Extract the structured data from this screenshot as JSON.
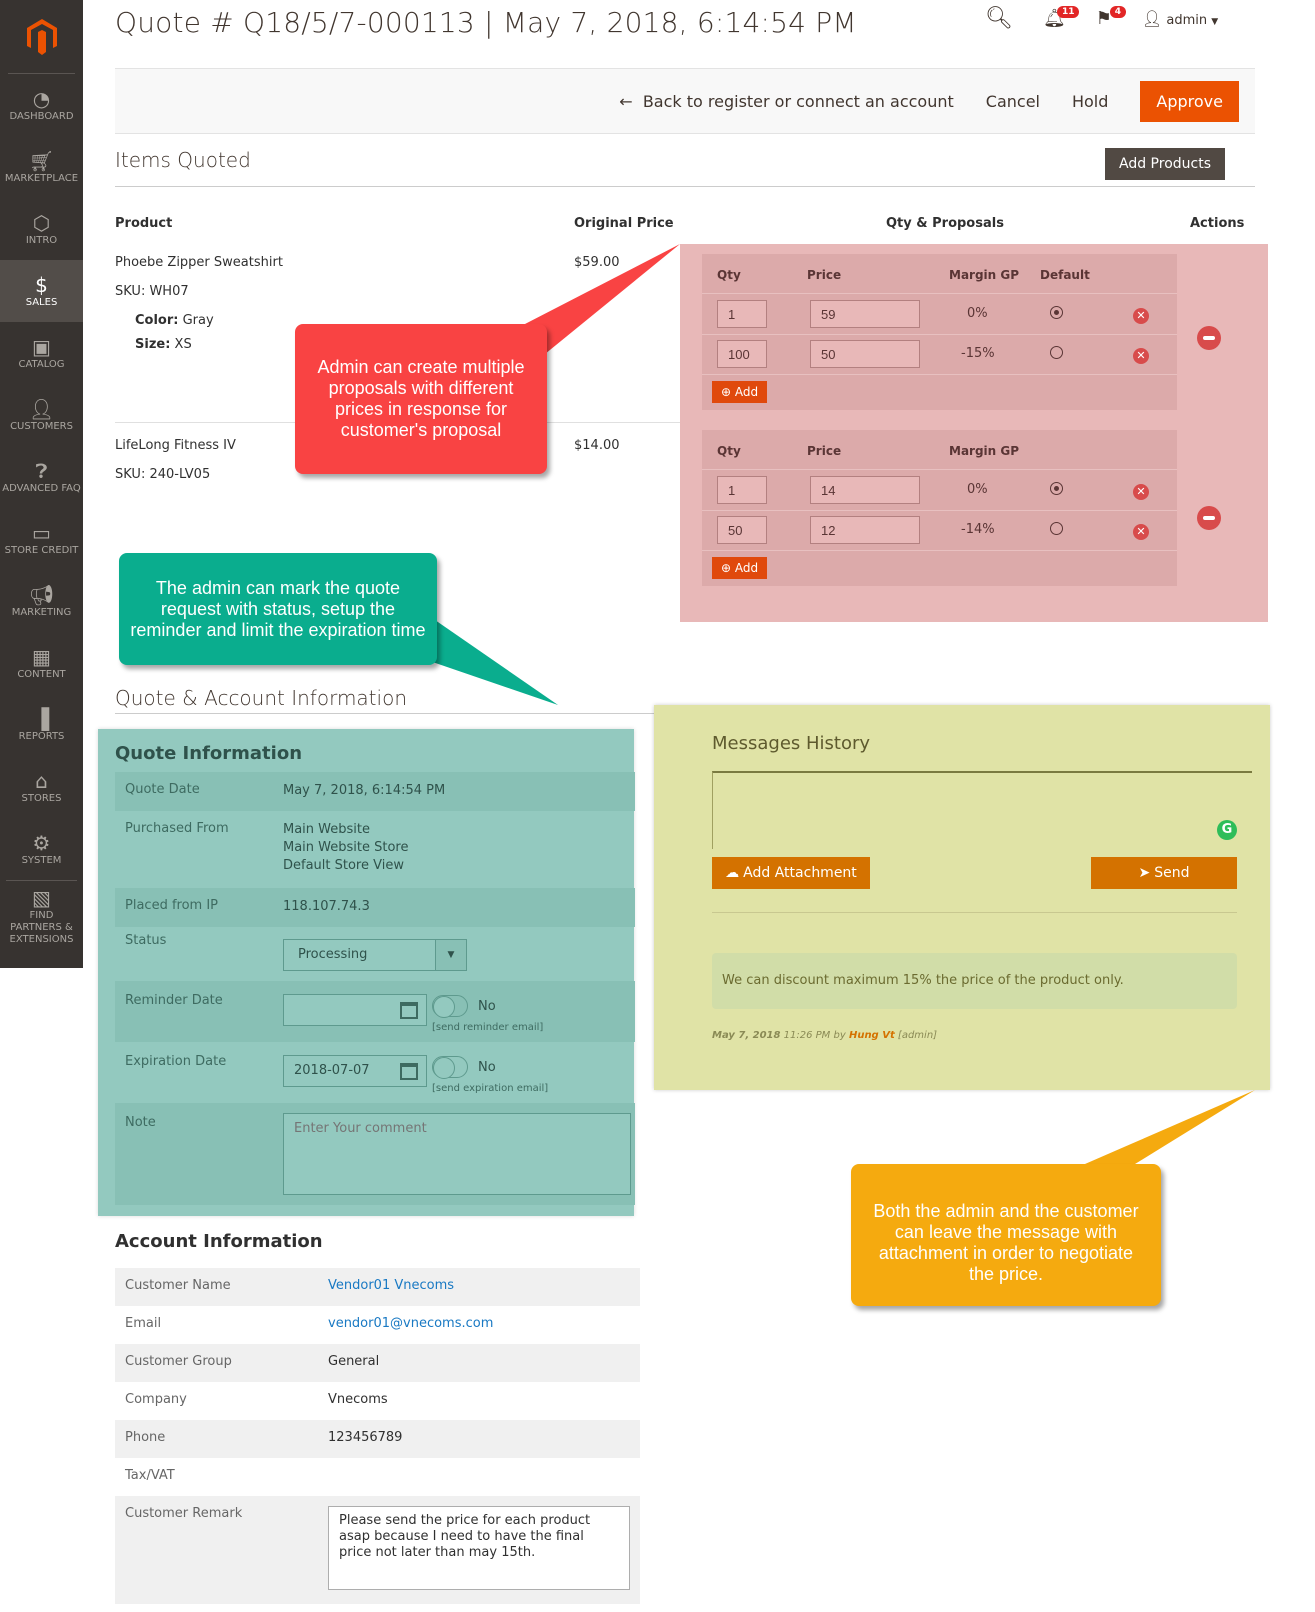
{
  "sidebar": {
    "items": [
      {
        "label": "DASHBOARD",
        "icon": "dashboard-icon"
      },
      {
        "label": "MARKETPLACE",
        "icon": "cart-icon"
      },
      {
        "label": "INTRO",
        "icon": "hexagon-icon"
      },
      {
        "label": "SALES",
        "icon": "dollar-icon",
        "active": true
      },
      {
        "label": "CATALOG",
        "icon": "box-icon"
      },
      {
        "label": "CUSTOMERS",
        "icon": "person-icon"
      },
      {
        "label": "ADVANCED FAQ",
        "icon": "question-icon"
      },
      {
        "label": "STORE CREDIT",
        "icon": "credit-card-icon"
      },
      {
        "label": "MARKETING",
        "icon": "megaphone-icon"
      },
      {
        "label": "CONTENT",
        "icon": "layout-icon"
      },
      {
        "label": "REPORTS",
        "icon": "bar-chart-icon"
      },
      {
        "label": "STORES",
        "icon": "store-icon"
      },
      {
        "label": "SYSTEM",
        "icon": "gear-icon"
      },
      {
        "label": "FIND PARTNERS & EXTENSIONS",
        "icon": "lego-icon"
      }
    ]
  },
  "header": {
    "title": "Quote # Q18/5/7-000113 | May 7, 2018, 6:14:54 PM",
    "notifications_count": "11",
    "flags_count": "4",
    "user": "admin"
  },
  "actions": {
    "back": "Back to register or connect an account",
    "cancel": "Cancel",
    "hold": "Hold",
    "approve": "Approve"
  },
  "items_quoted": {
    "title": "Items Quoted",
    "add_products": "Add Products",
    "columns": {
      "product": "Product",
      "original_price": "Original Price",
      "qty_proposals": "Qty & Proposals",
      "actions": "Actions"
    },
    "proposal_headers": {
      "qty": "Qty",
      "price": "Price",
      "margin": "Margin GP",
      "default": "Default"
    },
    "add_label": "Add",
    "products": [
      {
        "name": "Phoebe Zipper Sweatshirt",
        "sku": "SKU: WH07",
        "options": [
          {
            "label": "Color:",
            "value": "Gray"
          },
          {
            "label": "Size:",
            "value": "XS"
          }
        ],
        "original_price": "$59.00",
        "proposals": [
          {
            "qty": "1",
            "price": "59",
            "margin": "0%",
            "default": true
          },
          {
            "qty": "100",
            "price": "50",
            "margin": "-15%",
            "default": false
          }
        ]
      },
      {
        "name": "LifeLong Fitness IV",
        "sku": "SKU: 240-LV05",
        "options": [],
        "original_price": "$14.00",
        "proposals": [
          {
            "qty": "1",
            "price": "14",
            "margin": "0%",
            "default": true
          },
          {
            "qty": "50",
            "price": "12",
            "margin": "-14%",
            "default": false
          }
        ]
      }
    ]
  },
  "callouts": {
    "red": "Admin can create multiple proposals with different prices in response for customer's proposal",
    "teal": "The admin can mark the quote request with status, setup the reminder and limit the expiration time",
    "orange": "Both the admin and the customer can leave the message with attachment in order to negotiate the price."
  },
  "quote_account": {
    "title": "Quote & Account Information",
    "quote_info": {
      "title": "Quote Information",
      "quote_date_label": "Quote Date",
      "quote_date": "May 7, 2018, 6:14:54 PM",
      "purchased_from_label": "Purchased From",
      "purchased_from": [
        "Main Website",
        "Main Website Store",
        "Default Store View"
      ],
      "ip_label": "Placed from IP",
      "ip": "118.107.74.3",
      "status_label": "Status",
      "status": "Processing",
      "reminder_label": "Reminder Date",
      "reminder_value": "",
      "reminder_toggle": "No",
      "reminder_hint": "[send reminder email]",
      "expiration_label": "Expiration Date",
      "expiration_value": "2018-07-07",
      "expiration_toggle": "No",
      "expiration_hint": "[send expiration email]",
      "note_label": "Note",
      "note_placeholder": "Enter Your comment"
    },
    "account_info": {
      "title": "Account Information",
      "rows": [
        {
          "label": "Customer Name",
          "value": "Vendor01 Vnecoms",
          "link": true
        },
        {
          "label": "Email",
          "value": "vendor01@vnecoms.com",
          "link": true
        },
        {
          "label": "Customer Group",
          "value": "General"
        },
        {
          "label": "Company",
          "value": "Vnecoms"
        },
        {
          "label": "Phone",
          "value": "123456789"
        },
        {
          "label": "Tax/VAT",
          "value": ""
        }
      ],
      "remark_label": "Customer Remark",
      "remark": "Please send the price for each product asap because I need to have the final price not later than may 15th."
    }
  },
  "messages": {
    "title": "Messages History",
    "add_attachment": "Add Attachment",
    "send": "Send",
    "items": [
      {
        "text": "We can discount maximum 15% the price of the product only.",
        "date": "May 7, 2018",
        "time": "11:26 PM",
        "by": "by",
        "author": "Hung Vt",
        "role": "[admin]"
      }
    ]
  }
}
